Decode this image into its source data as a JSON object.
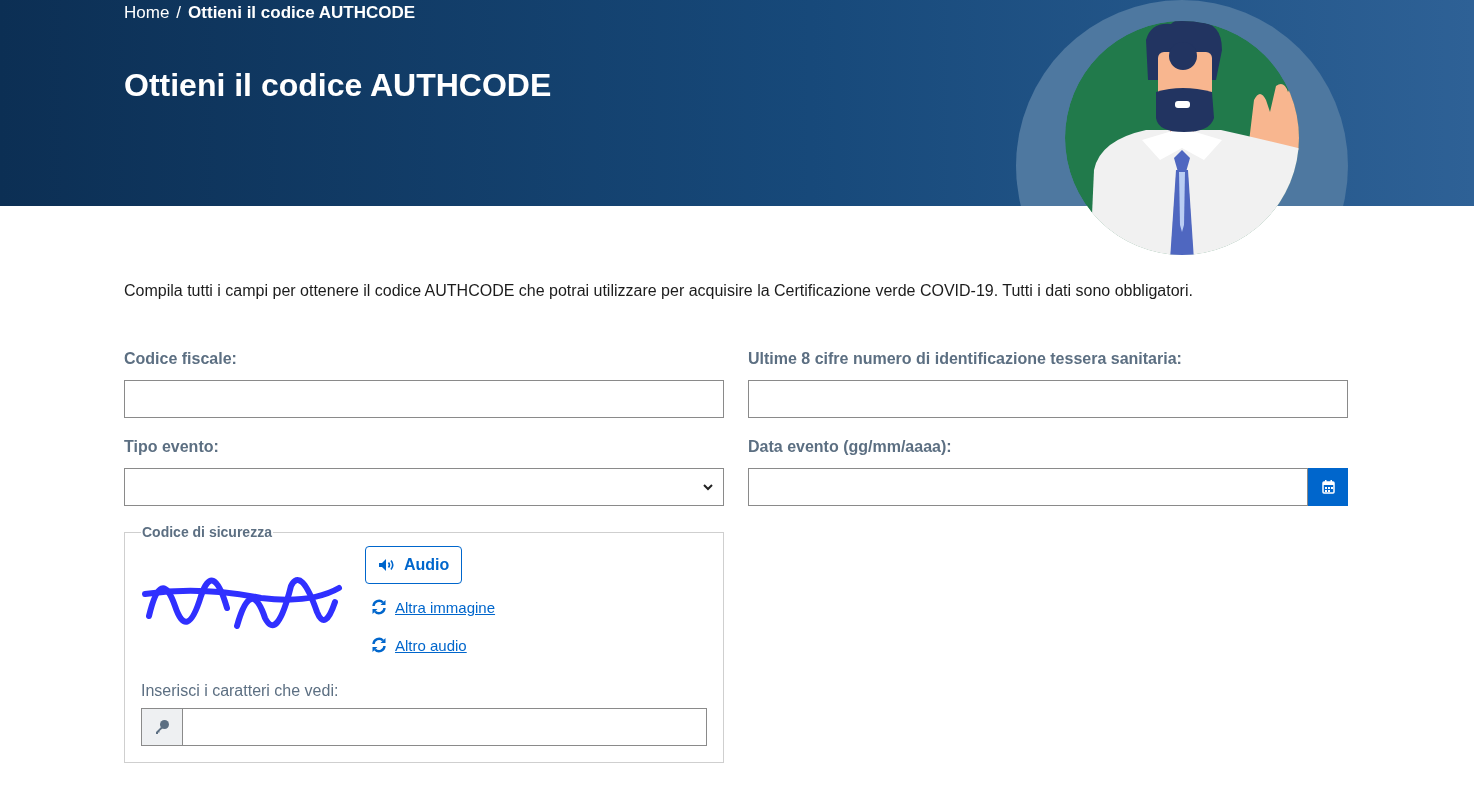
{
  "breadcrumb": {
    "separator": "/",
    "items": [
      {
        "label": "Home",
        "current": false
      },
      {
        "label": "Ottieni il codice AUTHCODE",
        "current": true
      }
    ]
  },
  "title": "Ottieni il codice AUTHCODE",
  "intro": "Compila tutti i campi per ottenere il codice AUTHCODE che potrai utilizzare per acquisire la Certificazione verde COVID-19. Tutti i dati sono obbligatori.",
  "fields": [
    {
      "kind": "text",
      "label": "Codice fiscale:"
    },
    {
      "kind": "text",
      "label": "Ultime 8 cifre numero di identificazione tessera sanitaria:"
    },
    {
      "kind": "select",
      "label": "Tipo evento:"
    },
    {
      "kind": "date",
      "label": "Data evento (gg/mm/aaaa):"
    }
  ],
  "captcha": {
    "legend": "Codice di sicurezza",
    "audio_button": "Audio",
    "links": [
      "Altra immagine",
      "Altro audio"
    ],
    "input_label": "Inserisci i caratteri che vedi:"
  }
}
